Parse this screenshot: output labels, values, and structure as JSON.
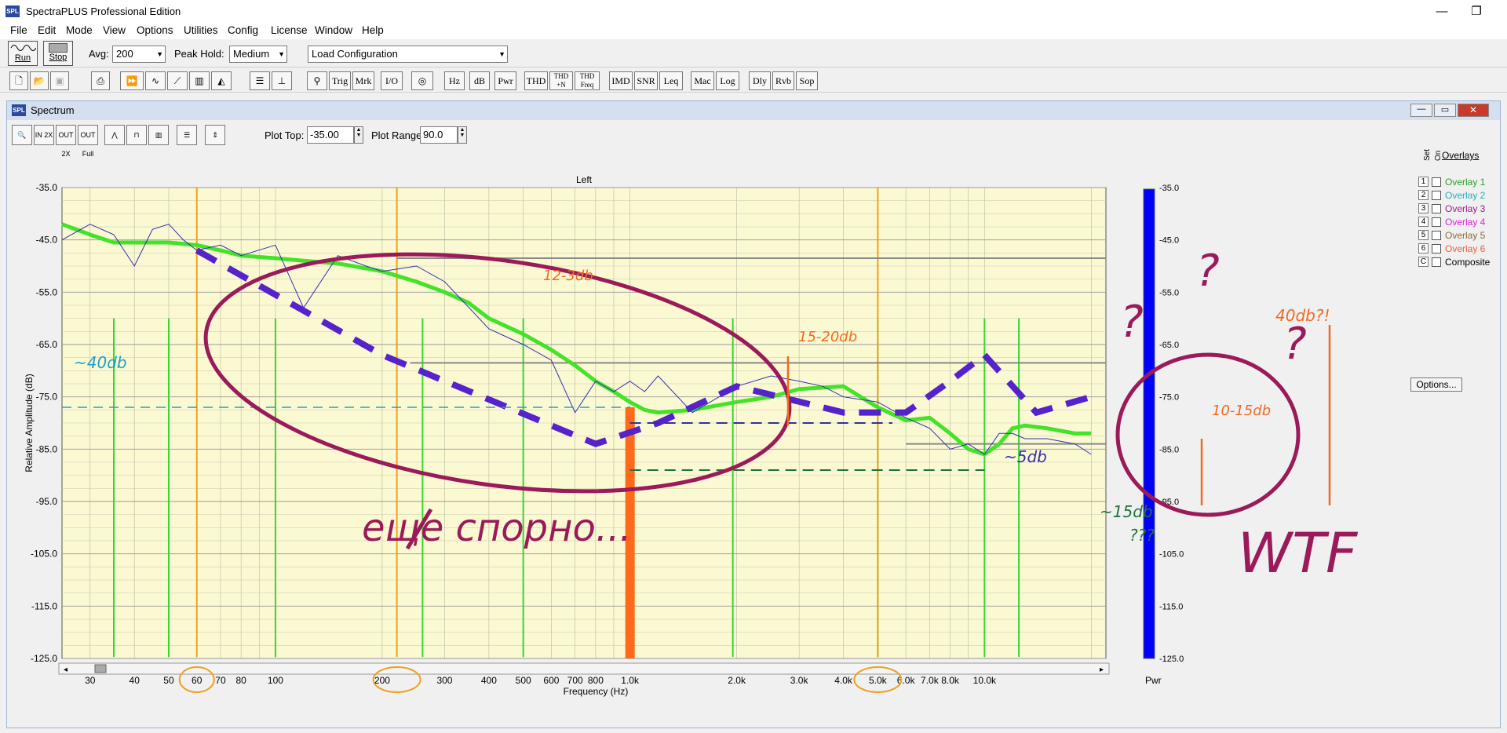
{
  "app": {
    "title": "SpectraPLUS Professional Edition"
  },
  "menu": [
    "File",
    "Edit",
    "Mode",
    "View",
    "Options",
    "Utilities",
    "Config",
    "License",
    "Window",
    "Help"
  ],
  "toolbar": {
    "run_label": "Run",
    "stop_label": "Stop",
    "avg_label": "Avg:",
    "avg_value": "200",
    "peak_label": "Peak Hold:",
    "peak_value": "Medium",
    "config_value": "Load Configuration",
    "buttons": [
      "Hz",
      "dB",
      "Pwr",
      "THD",
      "THD +N",
      "THD Freq",
      "IMD",
      "SNR",
      "Leq",
      "Mac",
      "Log",
      "Dly",
      "Rvb",
      "Sop",
      "Trig",
      "Mrk",
      "I/O"
    ]
  },
  "spectrum_window": {
    "title": "Spectrum",
    "plot_top_label": "Plot Top:",
    "plot_top_value": "-35.00",
    "plot_range_label": "Plot Range:",
    "plot_range_value": "90.0"
  },
  "overlays": {
    "title": "Overlays",
    "header_set": "Set",
    "header_on": "On",
    "items": [
      {
        "num": "1",
        "label": "Overlay 1",
        "color": "#2aa02a"
      },
      {
        "num": "2",
        "label": "Overlay 2",
        "color": "#20b0c0"
      },
      {
        "num": "3",
        "label": "Overlay 3",
        "color": "#9a2090"
      },
      {
        "num": "4",
        "label": "Overlay 4",
        "color": "#e020e0"
      },
      {
        "num": "5",
        "label": "Overlay 5",
        "color": "#8a6a3a"
      },
      {
        "num": "6",
        "label": "Overlay 6",
        "color": "#f06030"
      },
      {
        "num": "C",
        "label": "Composite",
        "color": "#000000"
      }
    ],
    "options_label": "Options..."
  },
  "chart_data": {
    "type": "line",
    "title": "Left",
    "xlabel": "Frequency (Hz)",
    "ylabel": "Relative Amplitude (dB)",
    "x_scale": "log",
    "xlim": [
      25,
      22000
    ],
    "ylim": [
      -125,
      -35
    ],
    "x_ticks": [
      30,
      40,
      50,
      60,
      70,
      80,
      100,
      200,
      300,
      400,
      500,
      600,
      700,
      800,
      1000,
      2000,
      3000,
      4000,
      5000,
      6000,
      7000,
      8000,
      10000
    ],
    "x_tick_labels": [
      "30",
      "40",
      "50",
      "60",
      "70",
      "80",
      "100",
      "200",
      "300",
      "400",
      "500",
      "600",
      "700",
      "800",
      "1.0k",
      "2.0k",
      "3.0k",
      "4.0k",
      "5.0k",
      "6.0k",
      "7.0k",
      "8.0k",
      "10.0k"
    ],
    "y_ticks": [
      -35,
      -45,
      -55,
      -65,
      -75,
      -85,
      -95,
      -105,
      -115,
      -125
    ],
    "y_tick_labels": [
      "-35.0",
      "-45.0",
      "-55.0",
      "-65.0",
      "-75.0",
      "-85.0",
      "-95.0",
      "-105.0",
      "-115.0",
      "-125.0"
    ],
    "right_axis_label": "Pwr",
    "grid": true,
    "series": [
      {
        "x": [
          25,
          30,
          35,
          40,
          45,
          50,
          60,
          70,
          80,
          100,
          120,
          150,
          200,
          250,
          300,
          350,
          400,
          500,
          600,
          700,
          800,
          900,
          1000,
          1100,
          1200,
          1500,
          2000,
          2500,
          3000,
          4000,
          5000,
          6000,
          7000,
          8000,
          9000,
          10000,
          11000,
          12000,
          13000,
          15000,
          18000,
          20000
        ],
        "y": [
          -42,
          -44,
          -45.5,
          -45.5,
          -45.5,
          -45.5,
          -46,
          -47,
          -48,
          -48.5,
          -49,
          -49.5,
          -51,
          -53,
          -55,
          -57,
          -60,
          -63,
          -66,
          -69,
          -72,
          -74,
          -76,
          -77.5,
          -78,
          -77.5,
          -76,
          -75,
          -73.5,
          -73,
          -77,
          -79.5,
          -79,
          -82,
          -85,
          -86,
          -84,
          -81,
          -80.5,
          -81,
          -82,
          -82
        ]
      },
      {
        "x": [
          25,
          30,
          35,
          40,
          45,
          50,
          55,
          60,
          70,
          80,
          100,
          120,
          150,
          180,
          200,
          250,
          300,
          400,
          500,
          600,
          700,
          800,
          900,
          1000,
          1100,
          1200,
          1500,
          2000,
          2500,
          3000,
          3500,
          4000,
          5000,
          6000,
          7000,
          8000,
          9000,
          10000,
          11000,
          12000,
          13000,
          15000,
          18000,
          20000
        ],
        "y": [
          -45,
          -42,
          -44,
          -50,
          -43,
          -42,
          -45,
          -47,
          -46,
          -48,
          -46,
          -58,
          -48,
          -50,
          -51,
          -50,
          -53,
          -62,
          -65,
          -68,
          -78,
          -72,
          -74,
          -72,
          -74,
          -71,
          -78,
          -73,
          -71,
          -72,
          -73,
          -75,
          -76,
          -79,
          -81,
          -85,
          -84,
          -86,
          -82,
          -82,
          -83,
          -83,
          -84,
          -86
        ]
      }
    ]
  },
  "annotations": {
    "a_12_3db": "12-3db",
    "a_15_20db": "15-20db",
    "a_40db_left": "~40db",
    "a_5db": "~5db",
    "a_10_15db": "10-15db",
    "a_40db_right": "40db?!",
    "a_15db": "~15db",
    "a_qqq": "???",
    "a_question": "?",
    "a_wtf": "WTF",
    "a_russian": "еще спорно..."
  }
}
